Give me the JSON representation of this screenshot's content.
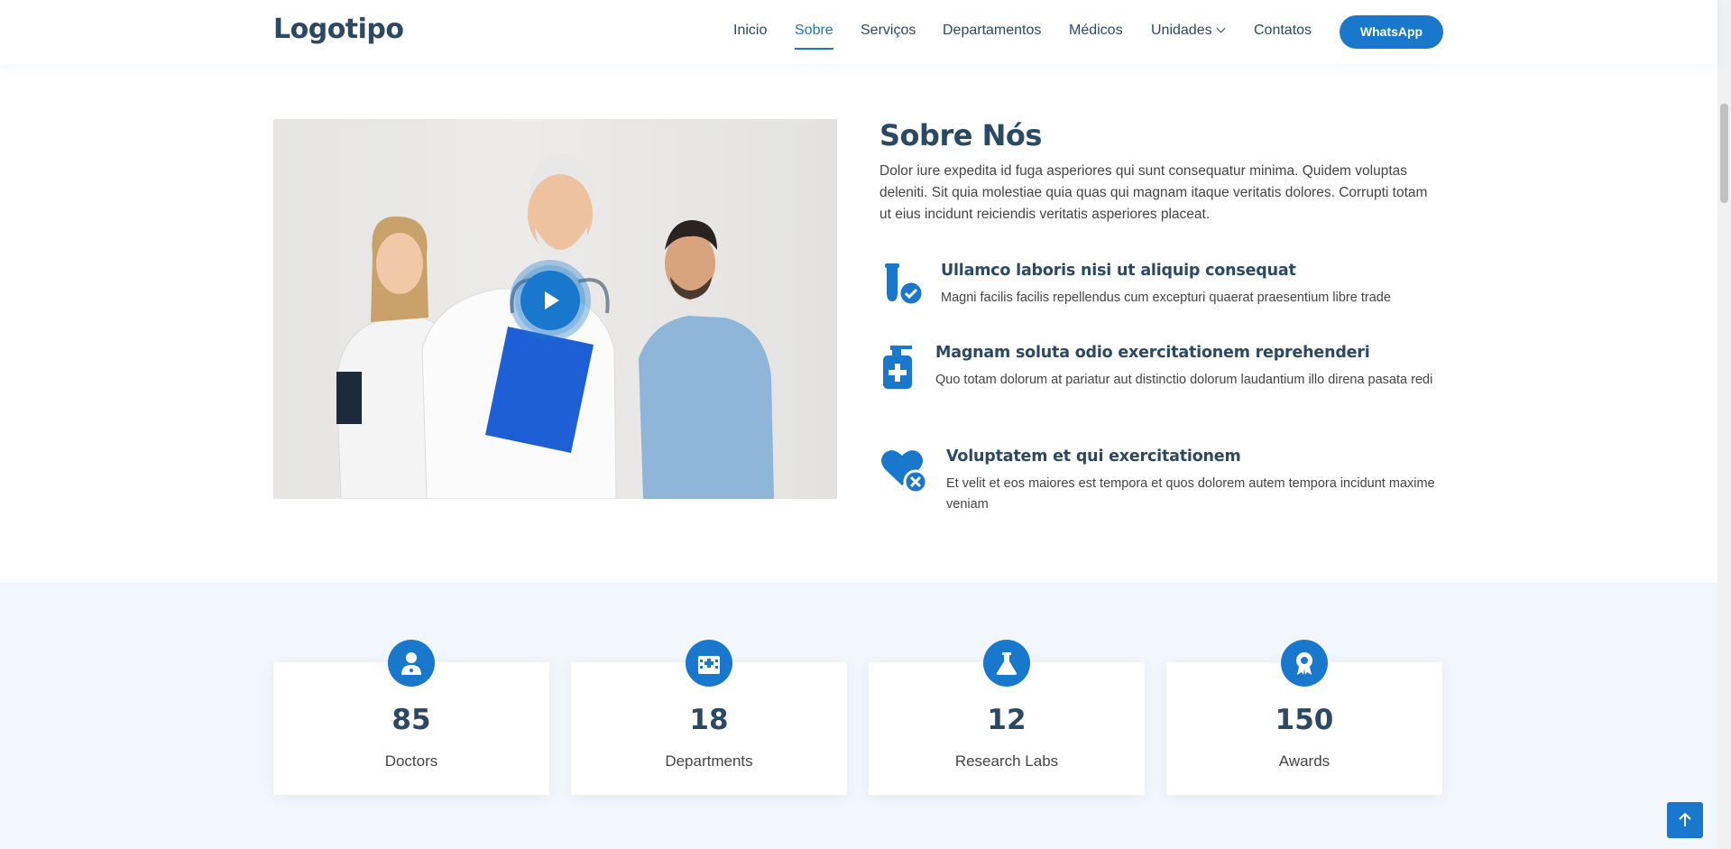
{
  "header": {
    "logo": "Logotipo",
    "nav": [
      {
        "label": "Inicio"
      },
      {
        "label": "Sobre"
      },
      {
        "label": "Serviços"
      },
      {
        "label": "Departamentos"
      },
      {
        "label": "Médicos"
      },
      {
        "label": "Unidades"
      },
      {
        "label": "Contatos"
      }
    ],
    "active_nav": "Sobre",
    "cta_label": "WhatsApp"
  },
  "about": {
    "title": "Sobre Nós",
    "text": "Dolor iure expedita id fuga asperiores qui sunt consequatur minima. Quidem voluptas deleniti. Sit quia molestiae quia quas qui magnam itaque veritatis dolores. Corrupti totam ut eius incidunt reiciendis veritatis asperiores placeat.",
    "features": [
      {
        "icon": "test-tube-check-icon",
        "title": "Ullamco laboris nisi ut aliquip consequat",
        "text": "Magni facilis facilis repellendus cum excepturi quaerat praesentium libre trade"
      },
      {
        "icon": "sanitizer-bottle-icon",
        "title": "Magnam soluta odio exercitationem reprehenderi",
        "text": "Quo totam dolorum at pariatur aut distinctio dolorum laudantium illo direna pasata redi"
      },
      {
        "icon": "heart-x-icon",
        "title": "Voluptatem et qui exercitationem",
        "text": "Et velit et eos maiores est tempora et quos dolorem autem tempora incidunt maxime veniam"
      }
    ]
  },
  "stats": [
    {
      "icon": "doctor-icon",
      "value": "85",
      "label": "Doctors"
    },
    {
      "icon": "hospital-icon",
      "value": "18",
      "label": "Departments"
    },
    {
      "icon": "flask-icon",
      "value": "12",
      "label": "Research Labs"
    },
    {
      "icon": "award-icon",
      "value": "150",
      "label": "Awards"
    }
  ],
  "colors": {
    "accent": "#1977cc",
    "heading": "#2c4964",
    "stats_bg": "#f1f7fd"
  }
}
